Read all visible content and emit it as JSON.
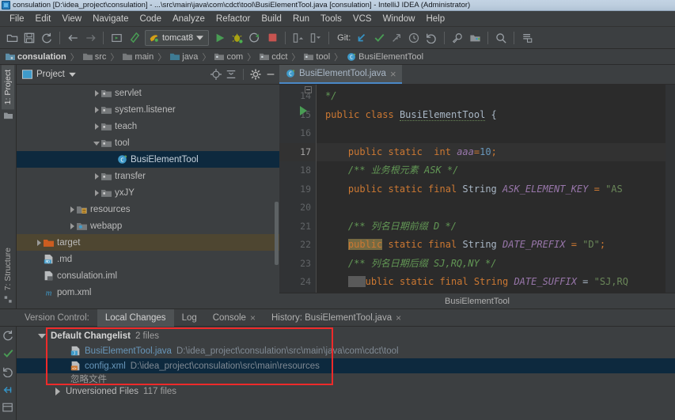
{
  "window": {
    "title": "consulation [D:\\idea_project\\consulation] - ...\\src\\main\\java\\com\\cdct\\tool\\BusiElementTool.java [consulation] - IntelliJ IDEA (Administrator)",
    "icon": "intellij-idea-icon"
  },
  "menubar": {
    "items": [
      {
        "label": "File"
      },
      {
        "label": "Edit"
      },
      {
        "label": "View"
      },
      {
        "label": "Navigate"
      },
      {
        "label": "Code"
      },
      {
        "label": "Analyze"
      },
      {
        "label": "Refactor"
      },
      {
        "label": "Build"
      },
      {
        "label": "Run"
      },
      {
        "label": "Tools"
      },
      {
        "label": "VCS"
      },
      {
        "label": "Window"
      },
      {
        "label": "Help"
      }
    ]
  },
  "toolbar": {
    "open_icon": "open-folder-icon",
    "save_icon": "save-icon",
    "sync_icon": "refresh-icon",
    "back_icon": "arrow-left-icon",
    "forward_icon": "arrow-right-icon",
    "compile_icon": "compile-icon",
    "build_icon": "hammer-icon",
    "run_config": "tomcat8",
    "run_config_icon": "tomcat-icon",
    "run_config_chevron": "chevron-down-icon",
    "run_icon": "run-icon",
    "debug_icon": "debug-bug-icon",
    "rerun_icon": "rerun-icon",
    "stop_icon": "stop-icon",
    "deploy_icon": "deploy-icon",
    "undeploy_icon": "undeploy-icon",
    "git_label": "Git:",
    "git_update_icon": "git-update-icon",
    "git_commit_icon": "git-commit-check-icon",
    "git_push_icon": "git-push-icon",
    "git_history_icon": "clock-history-icon",
    "git_revert_icon": "revert-icon",
    "settings_icon": "wrench-icon",
    "project_structure_icon": "project-structure-icon",
    "search_icon": "search-icon",
    "database_icon": "database-icon"
  },
  "breadcrumb": {
    "items": [
      {
        "label": "consulation",
        "icon": "module-icon",
        "bold": true
      },
      {
        "label": "src",
        "icon": "folder-icon",
        "bold": false
      },
      {
        "label": "main",
        "icon": "folder-icon",
        "bold": false
      },
      {
        "label": "java",
        "icon": "source-folder-icon",
        "bold": false
      },
      {
        "label": "com",
        "icon": "package-icon",
        "bold": false
      },
      {
        "label": "cdct",
        "icon": "package-icon",
        "bold": false
      },
      {
        "label": "tool",
        "icon": "package-icon",
        "bold": false
      },
      {
        "label": "BusiElementTool",
        "icon": "java-class-icon",
        "bold": false
      }
    ],
    "separator": "〉"
  },
  "left_rail": {
    "project_tab": "1: Project",
    "project_tab_icon": "project-icon",
    "structure_tab": "7: Structure",
    "structure_tab_icon": "structure-icon"
  },
  "project_panel": {
    "title": "Project",
    "title_icon": "project-view-icon",
    "chevron": "chevron-down-icon",
    "locate_icon": "target-locate-icon",
    "collapse_icon": "collapse-all-icon",
    "settings_icon": "gear-icon",
    "hide_icon": "minimize-icon",
    "tree": [
      {
        "label": "servlet",
        "icon": "package-icon",
        "indent": 6,
        "state": "collapsed",
        "selected": "none"
      },
      {
        "label": "system.listener",
        "icon": "package-icon",
        "indent": 6,
        "state": "collapsed",
        "selected": "none"
      },
      {
        "label": "teach",
        "icon": "package-icon",
        "indent": 6,
        "state": "collapsed",
        "selected": "none"
      },
      {
        "label": "tool",
        "icon": "package-icon",
        "indent": 6,
        "state": "expanded",
        "selected": "none"
      },
      {
        "label": "BusiElementTool",
        "icon": "java-class-icon",
        "indent": 7,
        "state": "leaf",
        "selected": "blue"
      },
      {
        "label": "transfer",
        "icon": "package-icon",
        "indent": 6,
        "state": "collapsed",
        "selected": "none"
      },
      {
        "label": "yxJY",
        "icon": "package-icon",
        "indent": 6,
        "state": "collapsed",
        "selected": "none"
      },
      {
        "label": "resources",
        "icon": "resources-folder-icon",
        "indent": 4,
        "state": "collapsed",
        "selected": "none"
      },
      {
        "label": "webapp",
        "icon": "webapp-folder-icon",
        "indent": 4,
        "state": "collapsed",
        "selected": "none"
      },
      {
        "label": "target",
        "icon": "excluded-folder-icon",
        "indent": 2,
        "state": "collapsed",
        "selected": "tan"
      },
      {
        "label": ".md",
        "icon": "markdown-file-icon",
        "indent": 3,
        "state": "leaf",
        "selected": "none"
      },
      {
        "label": "consulation.iml",
        "icon": "iml-file-icon",
        "indent": 3,
        "state": "leaf",
        "selected": "none"
      },
      {
        "label": "pom.xml",
        "icon": "maven-file-icon",
        "indent": 3,
        "state": "leaf",
        "selected": "none"
      }
    ]
  },
  "editor": {
    "tab": {
      "label": "BusiElementTool.java",
      "icon": "java-class-icon",
      "close": "×"
    },
    "status_text": "BusiElementTool",
    "lines": [
      {
        "num": "14",
        "current": false,
        "changed": false
      },
      {
        "num": "15",
        "current": false,
        "changed": false
      },
      {
        "num": "16",
        "current": false,
        "changed": false
      },
      {
        "num": "17",
        "current": true,
        "changed": true
      },
      {
        "num": "18",
        "current": false,
        "changed": false
      },
      {
        "num": "19",
        "current": false,
        "changed": false
      },
      {
        "num": "20",
        "current": false,
        "changed": false
      },
      {
        "num": "21",
        "current": false,
        "changed": false
      },
      {
        "num": "22",
        "current": false,
        "changed": false
      },
      {
        "num": "23",
        "current": false,
        "changed": false
      },
      {
        "num": "24",
        "current": false,
        "changed": false
      }
    ],
    "code": {
      "l14": "*/",
      "l15_kw": "public class",
      "l15_cls": "BusiElementTool",
      "l15_brace": "{",
      "l17_kw": "public static",
      "l17_type": "int",
      "l17_name": "aaa",
      "l17_eq": "=",
      "l17_val": "10",
      "l17_semi": ";",
      "l18_comment": "/** 业务根元素 ASK */",
      "l19_kw": "public static final",
      "l19_type": "String",
      "l19_name": "ASK_ELEMENT_KEY",
      "l19_eq": "= ",
      "l19_val": "\"AS",
      "l21_comment": "/** 列名日期前缀 D */",
      "l22_kw1": "public",
      "l22_kw2": "static final",
      "l22_type": "String",
      "l22_name": "DATE_PREFIX",
      "l22_eq": "= ",
      "l22_val": "\"D\"",
      "l22_semi": ";",
      "l23_comment": "/** 列名日期后缀 SJ,RQ,NY */",
      "l24_kw": "ublic static final String",
      "l24_name": "DATE_SUFFIX",
      "l24_val": "\"SJ,RQ"
    }
  },
  "vcs": {
    "tabs": [
      {
        "label": "Version Control:",
        "active": false,
        "closable": false
      },
      {
        "label": "Local Changes",
        "active": true,
        "closable": false
      },
      {
        "label": "Log",
        "active": false,
        "closable": false
      },
      {
        "label": "Console",
        "active": false,
        "closable": true
      },
      {
        "label": "History: BusiElementTool.java",
        "active": false,
        "closable": true
      }
    ],
    "rail_icons": [
      "refresh-icon",
      "commit-check-icon",
      "rollback-icon",
      "shelve-icon",
      "group-by-icon"
    ],
    "changelist": {
      "name": "Default Changelist",
      "count": "2 files",
      "expand_icon": "chevron-down-icon",
      "files": [
        {
          "name": "BusiElementTool.java",
          "icon": "java-modified-file-icon",
          "path": "D:\\idea_project\\consulation\\src\\main\\java\\com\\cdct\\tool",
          "selected": false
        },
        {
          "name": "config.xml",
          "icon": "xml-modified-file-icon",
          "path": "D:\\idea_project\\consulation\\src\\main\\resources",
          "selected": true
        }
      ]
    },
    "ignored_label": "忽略文件",
    "unversioned": {
      "label": "Unversioned Files",
      "count": "117 files",
      "expand_icon": "chevron-right-icon"
    }
  },
  "annotation": {
    "highlight_color": "#ee2a2a"
  }
}
